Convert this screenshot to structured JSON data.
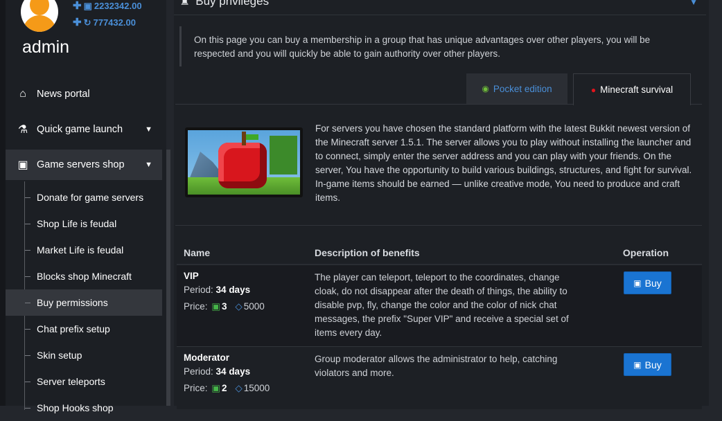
{
  "user": {
    "name": "admin",
    "balance_money": "2232342.00",
    "balance_bonus": "777432.00"
  },
  "sidebar": {
    "items": [
      {
        "label": "News portal",
        "icon": "home-icon"
      },
      {
        "label": "Quick game launch",
        "icon": "flask-icon"
      },
      {
        "label": "Game servers shop",
        "icon": "money-icon"
      }
    ],
    "submenu": [
      {
        "label": "Donate for game servers"
      },
      {
        "label": "Shop Life is feudal"
      },
      {
        "label": "Market Life is feudal"
      },
      {
        "label": "Blocks shop Minecraft"
      },
      {
        "label": "Buy permissions",
        "active": true
      },
      {
        "label": "Chat prefix setup"
      },
      {
        "label": "Skin setup"
      },
      {
        "label": "Server teleports"
      },
      {
        "label": "Shop Hooks shop"
      }
    ]
  },
  "panel": {
    "title": "Buy privileges",
    "intro": "On this page you can buy a membership in a group that has unique advantages over other players, you will be respected and you will quickly be able to gain authority over other players."
  },
  "tabs": [
    {
      "label": "Pocket edition",
      "icon": "android-icon"
    },
    {
      "label": "Minecraft survival",
      "icon": "apple-icon",
      "active": true
    }
  ],
  "server": {
    "description": "For servers you have chosen the standard platform with the latest Bukkit newest version of the Minecraft server 1.5.1. The server allows you to play without installing the launcher and to connect, simply enter the server address and you can play with your friends. On the server, You have the opportunity to build various buildings, structures, and fight for survival. In-game items should be earned — unlike creative mode, You need to produce and craft items."
  },
  "table": {
    "headers": {
      "name": "Name",
      "desc": "Description of benefits",
      "op": "Operation"
    },
    "period_label": "Period:",
    "price_label": "Price:",
    "buy_label": "Buy",
    "rows": [
      {
        "name": "VIP",
        "period": "34 days",
        "price_money": "3",
        "price_gems": "5000",
        "description": "The player can teleport, teleport to the coordinates, change cloak, do not disappear after the death of things, the ability to disable pvp, fly, change the color and the color of nick chat messages, the prefix \"Super VIP\" and receive a special set of items every day."
      },
      {
        "name": "Moderator",
        "period": "34 days",
        "price_money": "2",
        "price_gems": "15000",
        "description": "Group moderator allows the administrator to help, catching violators and more."
      }
    ]
  },
  "colors": {
    "accent": "#1a74d2",
    "link": "#4a8fd8",
    "money": "#46b649"
  }
}
